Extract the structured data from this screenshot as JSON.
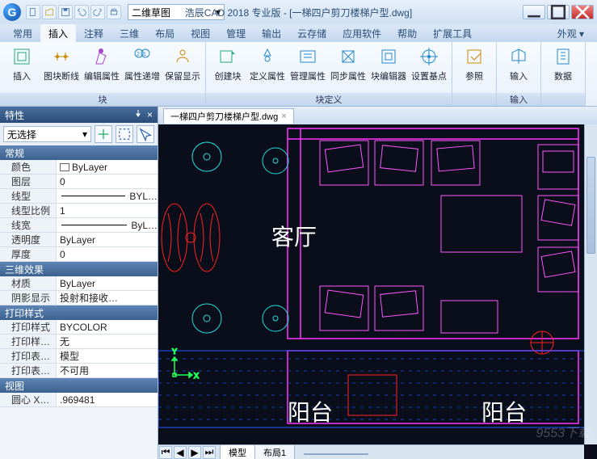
{
  "title": "浩辰CAD 2018 专业版 - [一梯四户剪刀楼梯户型.dwg]",
  "mode_selector": "二维草图",
  "menu_tabs": [
    "常用",
    "插入",
    "注释",
    "三维",
    "布局",
    "视图",
    "管理",
    "输出",
    "云存储",
    "应用软件",
    "帮助",
    "扩展工具"
  ],
  "menu_right": [
    "外观"
  ],
  "active_menu": "插入",
  "ribbon": {
    "groups": [
      {
        "label": "块",
        "items": [
          "插入",
          "图块断线",
          "编辑属性",
          "属性递增",
          "保留显示"
        ]
      },
      {
        "label": "块定义",
        "items": [
          "创建块",
          "定义属性",
          "管理属性",
          "同步属性",
          "块编辑器",
          "设置基点"
        ]
      },
      {
        "label": "",
        "items": [
          "参照"
        ]
      },
      {
        "label": "输入",
        "items": [
          "输入"
        ]
      },
      {
        "label": "",
        "items": [
          "数据"
        ]
      }
    ]
  },
  "properties": {
    "title": "特性",
    "selector": "无选择",
    "sections": [
      {
        "head": "常规",
        "rows": [
          {
            "k": "颜色",
            "v": "ByLayer",
            "swatch": true
          },
          {
            "k": "图层",
            "v": "0"
          },
          {
            "k": "线型",
            "v": "BYL…",
            "line": true
          },
          {
            "k": "线型比例",
            "v": "1"
          },
          {
            "k": "线宽",
            "v": "ByL…",
            "line": true
          },
          {
            "k": "透明度",
            "v": "ByLayer"
          },
          {
            "k": "厚度",
            "v": "0"
          }
        ]
      },
      {
        "head": "三维效果",
        "rows": [
          {
            "k": "材质",
            "v": "ByLayer"
          },
          {
            "k": "阴影显示",
            "v": "投射和接收…"
          }
        ]
      },
      {
        "head": "打印样式",
        "rows": [
          {
            "k": "打印样式",
            "v": "BYCOLOR"
          },
          {
            "k": "打印样…",
            "v": "无"
          },
          {
            "k": "打印表…",
            "v": "模型"
          },
          {
            "k": "打印表…",
            "v": "不可用"
          }
        ]
      },
      {
        "head": "视图",
        "rows": [
          {
            "k": "圆心 X…",
            "v": ".969481"
          }
        ]
      }
    ]
  },
  "document_tab": "一梯四户剪刀楼梯户型.dwg",
  "room_labels": {
    "living": "客厅",
    "balcony1": "阳台",
    "balcony2": "阳台"
  },
  "model_tabs": [
    "模型",
    "布局1"
  ],
  "active_model_tab": "模型",
  "watermark": "9553下载"
}
